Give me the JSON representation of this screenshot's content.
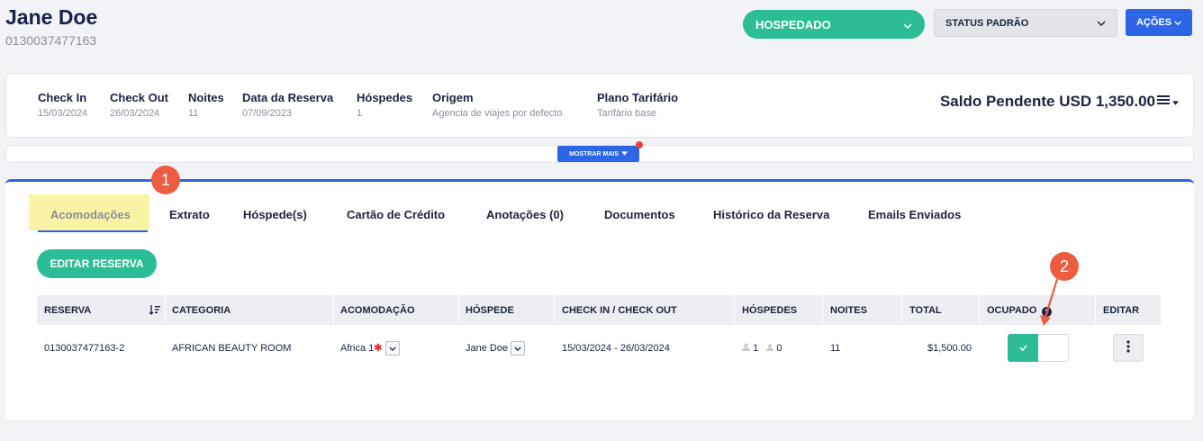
{
  "guest": {
    "name": "Jane Doe",
    "code": "0130037477163"
  },
  "top_actions": {
    "status": "HOSPEDADO",
    "status_standard": "STATUS PADRÃO",
    "actions": "AÇÕES"
  },
  "info": [
    {
      "label": "Check In",
      "value": "15/03/2024"
    },
    {
      "label": "Check Out",
      "value": "26/03/2024"
    },
    {
      "label": "Noites",
      "value": "11"
    },
    {
      "label": "Data da Reserva",
      "value": "07/09/2023"
    },
    {
      "label": "Hóspedes",
      "value": "1"
    },
    {
      "label": "Origem",
      "value": "Agencia de viajes por defecto"
    },
    {
      "label": "Plano Tarifário",
      "value": "Tarifário base"
    }
  ],
  "balance": "Saldo Pendente USD 1,350.00",
  "show_more": "MOSTRAR MAIS",
  "tabs": [
    "Acomodações",
    "Extrato",
    "Hóspede(s)",
    "Cartão de Crédito",
    "Anotações (0)",
    "Documentos",
    "Histórico da Reserva",
    "Emails Enviados"
  ],
  "callouts": [
    "1",
    "2"
  ],
  "edit_reservation": "EDITAR RESERVA",
  "table": {
    "headers": [
      "RESERVA",
      "CATEGORIA",
      "ACOMODAÇÃO",
      "HÓSPEDE",
      "CHECK IN / CHECK OUT",
      "HÓSPEDES",
      "NOITES",
      "TOTAL",
      "OCUPADO",
      "EDITAR"
    ],
    "rows": [
      {
        "reserva": "0130037477163-2",
        "categoria": "AFRICAN BEAUTY ROOM",
        "acomodacao": "Africa 1",
        "hospede": "Jane Doe",
        "periodo": "15/03/2024 - 26/03/2024",
        "adults": "1",
        "children": "0",
        "noites": "11",
        "total": "$1,500.00"
      }
    ]
  },
  "colors": {
    "accent": "#2c66e6",
    "green": "#2dbd96",
    "callout": "#ec5c41",
    "highlight": "#faf3a4"
  },
  "icons": [
    "chevron-down-icon",
    "sort-icon",
    "help-icon",
    "check-icon",
    "kebab-icon",
    "hamburger-icon",
    "person-icon"
  ]
}
